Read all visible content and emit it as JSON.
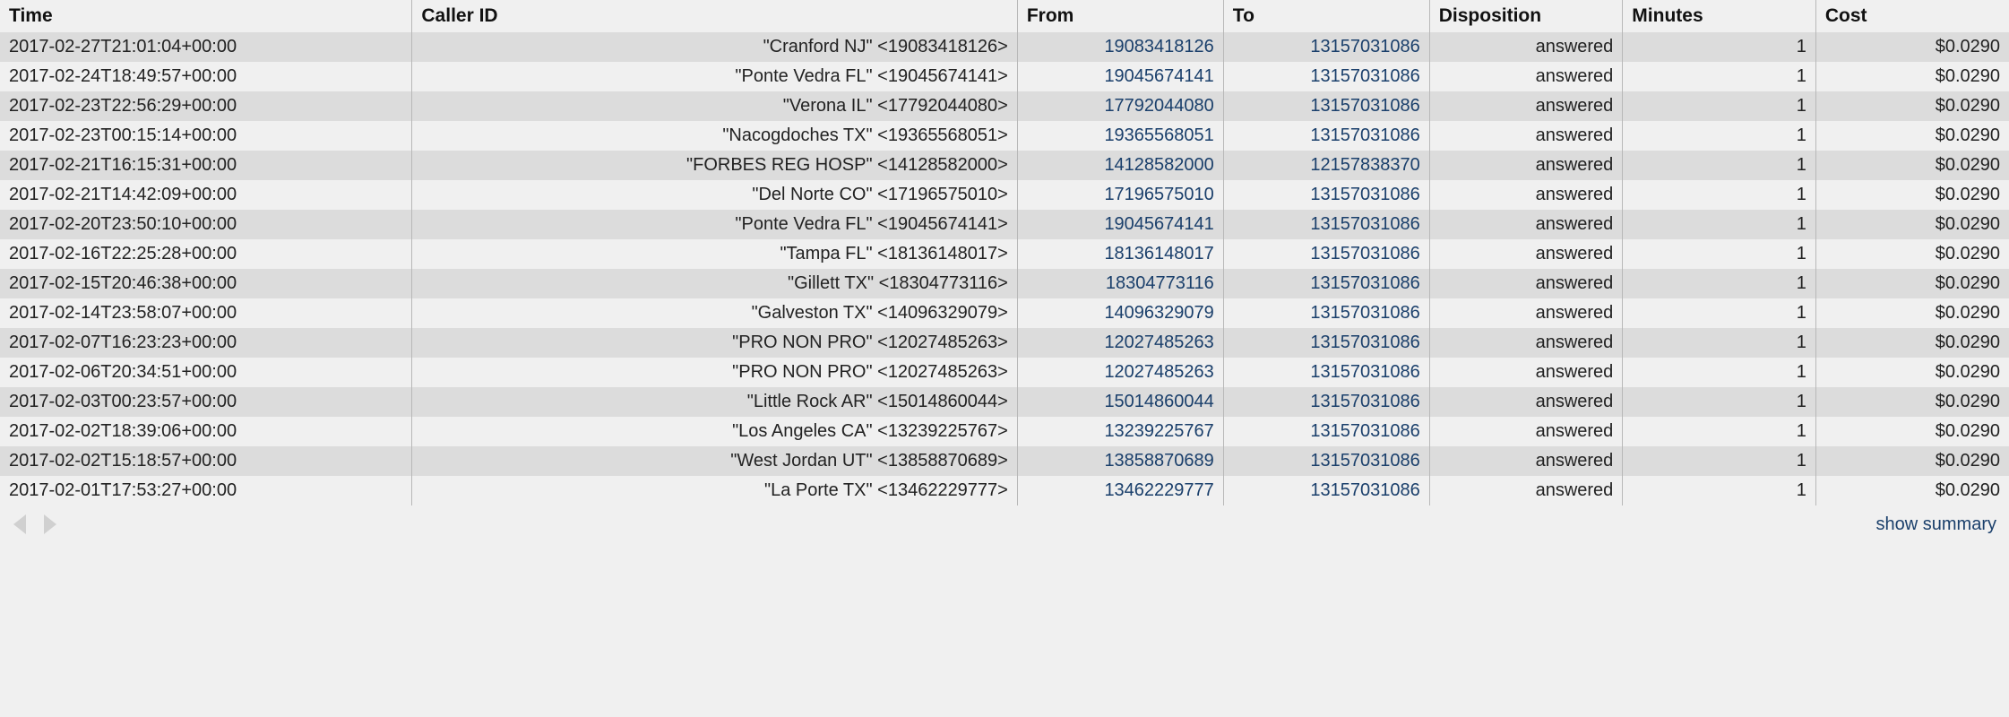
{
  "columns": {
    "time": "Time",
    "caller": "Caller ID",
    "from": "From",
    "to": "To",
    "disp": "Disposition",
    "min": "Minutes",
    "cost": "Cost"
  },
  "rows": [
    {
      "time": "2017-02-27T21:01:04+00:00",
      "caller": "\"Cranford NJ\" <19083418126>",
      "from": "19083418126",
      "to": "13157031086",
      "disp": "answered",
      "min": "1",
      "cost": "$0.0290"
    },
    {
      "time": "2017-02-24T18:49:57+00:00",
      "caller": "\"Ponte Vedra FL\" <19045674141>",
      "from": "19045674141",
      "to": "13157031086",
      "disp": "answered",
      "min": "1",
      "cost": "$0.0290"
    },
    {
      "time": "2017-02-23T22:56:29+00:00",
      "caller": "\"Verona IL\" <17792044080>",
      "from": "17792044080",
      "to": "13157031086",
      "disp": "answered",
      "min": "1",
      "cost": "$0.0290"
    },
    {
      "time": "2017-02-23T00:15:14+00:00",
      "caller": "\"Nacogdoches TX\" <19365568051>",
      "from": "19365568051",
      "to": "13157031086",
      "disp": "answered",
      "min": "1",
      "cost": "$0.0290"
    },
    {
      "time": "2017-02-21T16:15:31+00:00",
      "caller": "\"FORBES REG HOSP\" <14128582000>",
      "from": "14128582000",
      "to": "12157838370",
      "disp": "answered",
      "min": "1",
      "cost": "$0.0290"
    },
    {
      "time": "2017-02-21T14:42:09+00:00",
      "caller": "\"Del Norte CO\" <17196575010>",
      "from": "17196575010",
      "to": "13157031086",
      "disp": "answered",
      "min": "1",
      "cost": "$0.0290"
    },
    {
      "time": "2017-02-20T23:50:10+00:00",
      "caller": "\"Ponte Vedra FL\" <19045674141>",
      "from": "19045674141",
      "to": "13157031086",
      "disp": "answered",
      "min": "1",
      "cost": "$0.0290"
    },
    {
      "time": "2017-02-16T22:25:28+00:00",
      "caller": "\"Tampa FL\" <18136148017>",
      "from": "18136148017",
      "to": "13157031086",
      "disp": "answered",
      "min": "1",
      "cost": "$0.0290"
    },
    {
      "time": "2017-02-15T20:46:38+00:00",
      "caller": "\"Gillett TX\" <18304773116>",
      "from": "18304773116",
      "to": "13157031086",
      "disp": "answered",
      "min": "1",
      "cost": "$0.0290"
    },
    {
      "time": "2017-02-14T23:58:07+00:00",
      "caller": "\"Galveston TX\" <14096329079>",
      "from": "14096329079",
      "to": "13157031086",
      "disp": "answered",
      "min": "1",
      "cost": "$0.0290"
    },
    {
      "time": "2017-02-07T16:23:23+00:00",
      "caller": "\"PRO NON PRO\" <12027485263>",
      "from": "12027485263",
      "to": "13157031086",
      "disp": "answered",
      "min": "1",
      "cost": "$0.0290"
    },
    {
      "time": "2017-02-06T20:34:51+00:00",
      "caller": "\"PRO NON PRO\" <12027485263>",
      "from": "12027485263",
      "to": "13157031086",
      "disp": "answered",
      "min": "1",
      "cost": "$0.0290"
    },
    {
      "time": "2017-02-03T00:23:57+00:00",
      "caller": "\"Little Rock AR\" <15014860044>",
      "from": "15014860044",
      "to": "13157031086",
      "disp": "answered",
      "min": "1",
      "cost": "$0.0290"
    },
    {
      "time": "2017-02-02T18:39:06+00:00",
      "caller": "\"Los Angeles CA\" <13239225767>",
      "from": "13239225767",
      "to": "13157031086",
      "disp": "answered",
      "min": "1",
      "cost": "$0.0290"
    },
    {
      "time": "2017-02-02T15:18:57+00:00",
      "caller": "\"West Jordan UT\" <13858870689>",
      "from": "13858870689",
      "to": "13157031086",
      "disp": "answered",
      "min": "1",
      "cost": "$0.0290"
    },
    {
      "time": "2017-02-01T17:53:27+00:00",
      "caller": "\"La Porte TX\" <13462229777>",
      "from": "13462229777",
      "to": "13157031086",
      "disp": "answered",
      "min": "1",
      "cost": "$0.0290"
    }
  ],
  "footer": {
    "summary_label": "show summary"
  }
}
